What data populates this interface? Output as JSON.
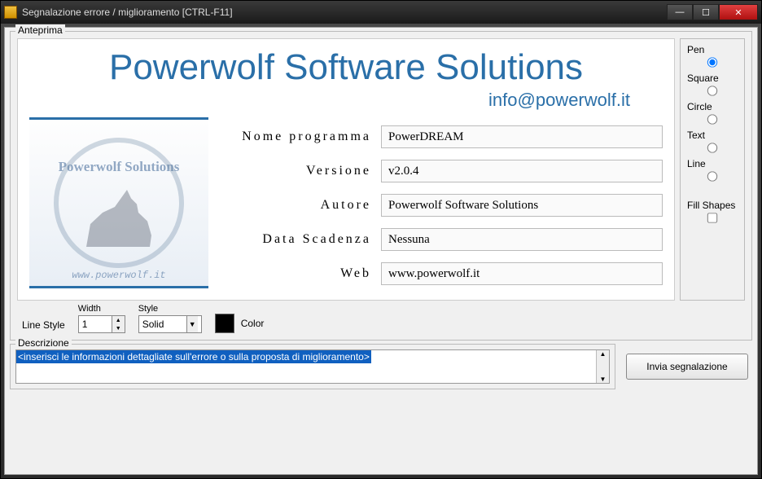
{
  "window": {
    "title": "Segnalazione errore / miglioramento [CTRL-F11]"
  },
  "preview": {
    "group_label": "Anteprima",
    "banner_title": "Powerwolf Software Solutions",
    "banner_email": "info@powerwolf.it",
    "logo_text": "Powerwolf Solutions",
    "logo_url": "www.powerwolf.it",
    "fields": {
      "program_label": "Nome programma",
      "program_value": "PowerDREAM",
      "version_label": "Versione",
      "version_value": "v2.0.4",
      "author_label": "Autore",
      "author_value": "Powerwolf Software Solutions",
      "expiry_label": "Data Scadenza",
      "expiry_value": "Nessuna",
      "web_label": "Web",
      "web_value": "www.powerwolf.it"
    }
  },
  "tools": {
    "pen": "Pen",
    "square": "Square",
    "circle": "Circle",
    "text": "Text",
    "line": "Line",
    "fill_shapes": "Fill Shapes"
  },
  "linestyle": {
    "label": "Line Style",
    "width_label": "Width",
    "width_value": "1",
    "style_label": "Style",
    "style_value": "Solid",
    "color_label": "Color",
    "color_value": "#000000"
  },
  "description": {
    "group_label": "Descrizione",
    "placeholder": "<inserisci le informazioni dettagliate sull'errore o sulla proposta di miglioramento>"
  },
  "actions": {
    "send_label": "Invia segnalazione"
  }
}
